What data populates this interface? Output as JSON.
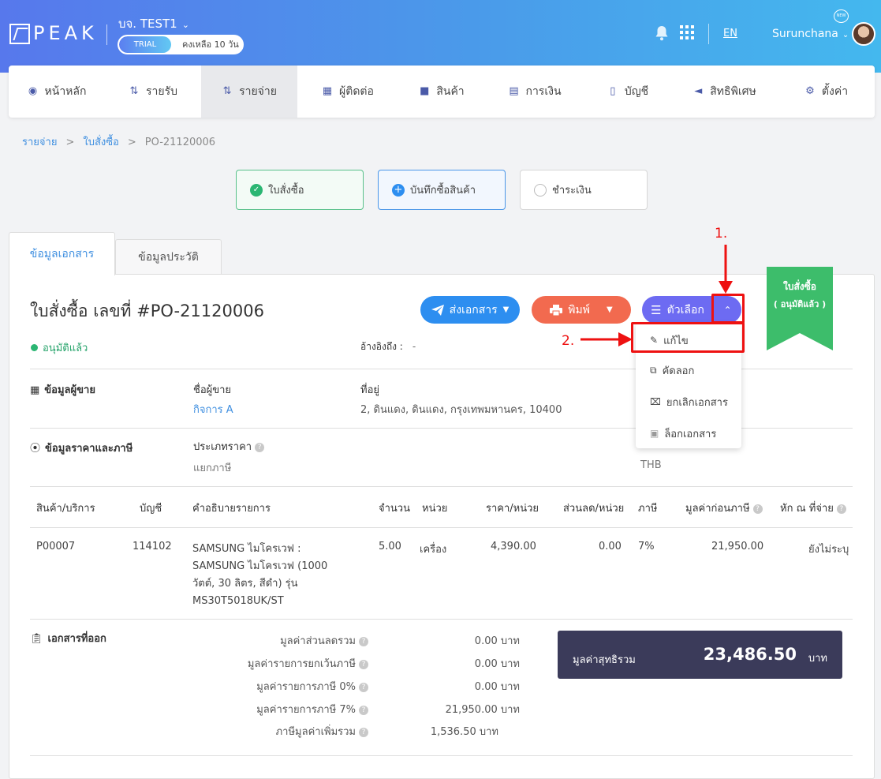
{
  "header": {
    "logo": "PEAK",
    "company": "บจ. TEST1",
    "trial_badge": "TRIAL",
    "trial_remaining": "คงเหลือ 10 วัน",
    "lang": "EN",
    "user": "Surunchana",
    "new_badge": "NEW"
  },
  "menu": {
    "items": [
      {
        "label": "หน้าหลัก",
        "icon": "dashboard-icon"
      },
      {
        "label": "รายรับ",
        "icon": "income-icon"
      },
      {
        "label": "รายจ่าย",
        "icon": "expense-icon"
      },
      {
        "label": "ผู้ติดต่อ",
        "icon": "contacts-icon"
      },
      {
        "label": "สินค้า",
        "icon": "box-icon"
      },
      {
        "label": "การเงิน",
        "icon": "money-icon"
      },
      {
        "label": "บัญชี",
        "icon": "book-icon"
      },
      {
        "label": "สิทธิพิเศษ",
        "icon": "megaphone-icon"
      },
      {
        "label": "ตั้งค่า",
        "icon": "gear-icon"
      }
    ]
  },
  "breadcrumb": {
    "level1": "รายจ่าย",
    "level2": "ใบสั่งซื้อ",
    "current": "PO-21120006",
    "sep": ">"
  },
  "steps": [
    {
      "label": "ใบสั่งซื้อ"
    },
    {
      "label": "บันทึกซื้อสินค้า"
    },
    {
      "label": "ชำระเงิน"
    }
  ],
  "tabs": {
    "info": "ข้อมูลเอกสาร",
    "history": "ข้อมูลประวัติ"
  },
  "document": {
    "title": "ใบสั่งซื้อ เลขที่ #PO-21120006",
    "status": "อนุมัติแล้ว",
    "ref_label": "อ้างอิงถึง :",
    "ref_value": "-",
    "ribbon_line1": "ใบสั่งซื้อ",
    "ribbon_line2": "( อนุมัติแล้ว )"
  },
  "actions": {
    "send": "ส่งเอกสาร",
    "print": "พิมพ์",
    "options": "ตัวเลือก"
  },
  "dropdown": {
    "items": [
      "แก้ไข",
      "คัดลอก",
      "ยกเลิกเอกสาร",
      "ล็อกเอกสาร"
    ]
  },
  "annotations": {
    "step1": "1.",
    "step2": "2."
  },
  "vendor": {
    "section": "ข้อมูลผู้ขาย",
    "name_label": "ชื่อผู้ขาย",
    "name_value": "กิจการ A",
    "address_label": "ที่อยู่",
    "address_value": "2, ดินแดง, ดินแดง, กรุงเทพมหานคร, 10400"
  },
  "pricing": {
    "section": "ข้อมูลราคาและภาษี",
    "price_type_label": "ประเภทราคา",
    "price_type_value": "แยกภาษี",
    "currency": "THB"
  },
  "items_table": {
    "headers": [
      "สินค้า/บริการ",
      "บัญชี",
      "คำอธิบายรายการ",
      "จำนวน",
      "หน่วย",
      "ราคา/หน่วย",
      "ส่วนลด/หน่วย",
      "ภาษี",
      "มูลค่าก่อนภาษี",
      "หัก ณ ที่จ่าย"
    ],
    "rows": [
      {
        "product": "P00007",
        "account": "114102",
        "description": "SAMSUNG ไมโครเวฟ  : SAMSUNG ไมโครเวฟ (1000 วัตต์, 30 ลิตร, สีดำ) รุ่น MS30T5018UK/ST",
        "qty": "5.00",
        "unit": "เครื่อง",
        "price": "4,390.00",
        "discount": "0.00",
        "vat": "7%",
        "pretax": "21,950.00",
        "wht": "ยังไม่ระบุ"
      }
    ]
  },
  "summary": {
    "section": "เอกสารที่ออก",
    "rows": [
      {
        "label": "มูลค่าส่วนลดรวม",
        "value": "0.00 บาท"
      },
      {
        "label": "มูลค่ารายการยกเว้นภาษี",
        "value": "0.00 บาท"
      },
      {
        "label": "มูลค่ารายการภาษี 0%",
        "value": "0.00 บาท"
      },
      {
        "label": "มูลค่ารายการภาษี 7%",
        "value": "21,950.00 บาท"
      },
      {
        "label": "ภาษีมูลค่าเพิ่มรวม",
        "value": "1,536.50 บาท"
      }
    ],
    "net_label": "มูลค่าสุทธิรวม",
    "net_value": "23,486.50",
    "net_unit": "บาท"
  },
  "colors": {
    "primary": "#2d8ef0",
    "print": "#f26a4f",
    "options": "#6d6bf2",
    "approved": "#2bb673",
    "annotation": "#e11111"
  }
}
